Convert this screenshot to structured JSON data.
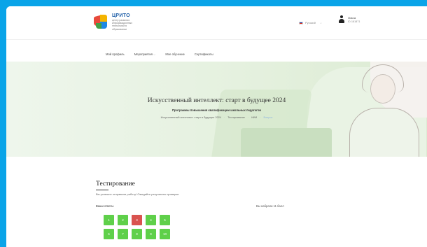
{
  "header": {
    "logo_title": "ЦРИТО",
    "logo_subtitle": "центр развития информационных технологий в образовании",
    "language": "Русский",
    "user_name": "Ольга",
    "user_id": "ID 181871"
  },
  "nav": {
    "items": [
      {
        "label": "Мой профиль"
      },
      {
        "label": "Мероприятия"
      },
      {
        "label": "Мое обучение"
      },
      {
        "label": "Сертификаты"
      }
    ]
  },
  "hero": {
    "title": "Искусственный интеллект: старт в будущее 2024",
    "subtitle": "Программы повышения квалификации школьных педагогов",
    "breadcrumb": [
      "Искусственный интеллект: старт в будущее 2024",
      "Тестирование",
      "ИИИ",
      "Вопрос"
    ]
  },
  "main": {
    "title": "Тестирование",
    "success_message": "Вы успешно отправили работу! Ожидайте результаты проверки",
    "answers_label": "Ваши ответы",
    "score_text": "Вы набрали 11 балл",
    "answers": [
      {
        "num": "1",
        "correct": true
      },
      {
        "num": "2",
        "correct": true
      },
      {
        "num": "3",
        "correct": false
      },
      {
        "num": "4",
        "correct": true
      },
      {
        "num": "5",
        "correct": true
      },
      {
        "num": "6",
        "correct": true
      },
      {
        "num": "7",
        "correct": true
      },
      {
        "num": "8",
        "correct": true
      },
      {
        "num": "9",
        "correct": true
      },
      {
        "num": "10",
        "correct": true
      }
    ]
  },
  "colors": {
    "frame_bg": "#0aa4e8",
    "correct": "#5fd04a",
    "wrong": "#d9534f",
    "hero_bg": "#e5f1df"
  }
}
